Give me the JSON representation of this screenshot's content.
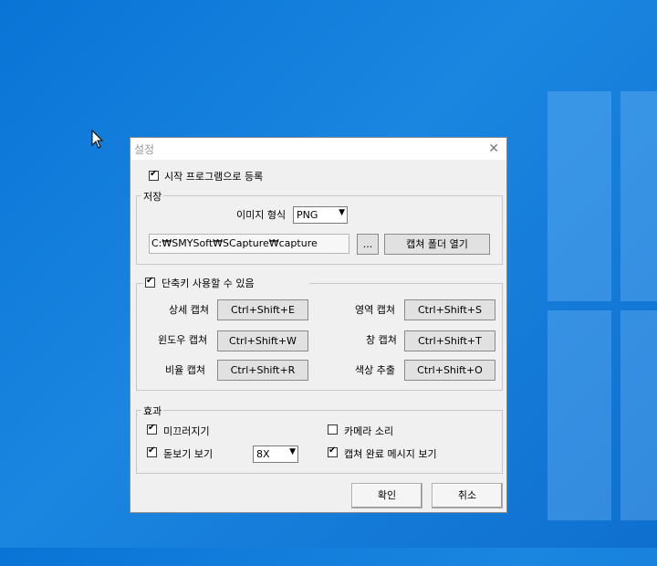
{
  "dialog": {
    "title": "설정",
    "close_icon": "close-icon"
  },
  "startup": {
    "label": "시작 프로그램으로 등록",
    "checked": true
  },
  "storage": {
    "title": "저장",
    "format_label": "이미지 형식",
    "format_value": "PNG",
    "path": "C:₩SMYSoft₩SCapture₩capture",
    "browse_label": "...",
    "open_folder_label": "캡쳐 폴더 열기"
  },
  "hotkeys": {
    "enable_label": "단축키 사용할 수 있음",
    "enabled": true,
    "items": [
      {
        "label": "상세 캡쳐",
        "key": "Ctrl+Shift+E"
      },
      {
        "label": "영역 캡쳐",
        "key": "Ctrl+Shift+S"
      },
      {
        "label": "윈도우 캡쳐",
        "key": "Ctrl+Shift+W"
      },
      {
        "label": "창 캡쳐",
        "key": "Ctrl+Shift+T"
      },
      {
        "label": "비율 캡쳐",
        "key": "Ctrl+Shift+R"
      },
      {
        "label": "색상 추출",
        "key": "Ctrl+Shift+O"
      }
    ]
  },
  "effects": {
    "title": "효과",
    "slide_label": "미끄러지기",
    "slide_checked": true,
    "camera_label": "카메라 소리",
    "camera_checked": false,
    "magnifier_label": "돋보기 보기",
    "magnifier_checked": true,
    "zoom_value": "8X",
    "message_label": "캡쳐 완료 메시지 보기",
    "message_checked": true
  },
  "footer": {
    "ok_label": "확인",
    "cancel_label": "취소"
  }
}
